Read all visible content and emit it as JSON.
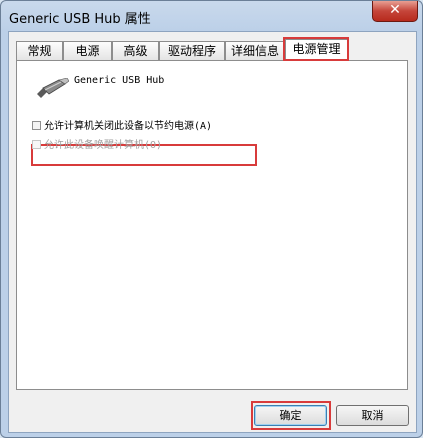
{
  "window": {
    "title": "Generic USB Hub 属性",
    "close_glyph": "✕"
  },
  "tabs": [
    {
      "label": "常规"
    },
    {
      "label": "电源"
    },
    {
      "label": "高级"
    },
    {
      "label": "驱动程序"
    },
    {
      "label": "详细信息"
    },
    {
      "label": "电源管理",
      "active": true
    }
  ],
  "device": {
    "name": "Generic USB Hub",
    "icon": "usb-plug-icon"
  },
  "options": [
    {
      "label": "允许计算机关闭此设备以节约电源(A)",
      "checked": false,
      "enabled": true
    },
    {
      "label": "允许此设备唤醒计算机(O)",
      "checked": false,
      "enabled": false
    }
  ],
  "buttons": {
    "ok": "确定",
    "cancel": "取消"
  },
  "colors": {
    "highlight": "#d83b3b"
  }
}
